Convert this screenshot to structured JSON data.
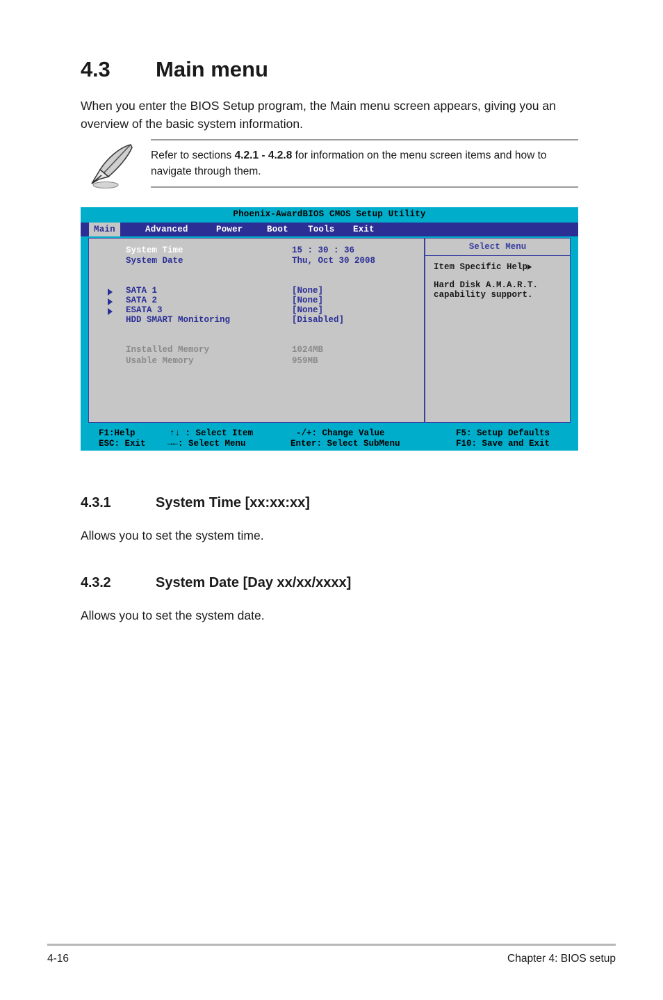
{
  "document": {
    "section": {
      "number": "4.3",
      "title": "Main menu",
      "intro": "When you enter the BIOS Setup program, the Main menu screen appears, giving you an overview of the basic system information."
    },
    "note": {
      "icon": "quill-pen-icon",
      "text_before": "Refer to sections ",
      "text_bold": "4.2.1 - 4.2.8",
      "text_after": " for information on the menu screen items and how to navigate through them."
    },
    "subsections": [
      {
        "number": "4.3.1",
        "title": "System Time [xx:xx:xx]",
        "body": "Allows you to set the system time."
      },
      {
        "number": "4.3.2",
        "title": "System Date [Day xx/xx/xxxx]",
        "body": "Allows you to set the system date."
      }
    ],
    "footer": {
      "page_number": "4-16",
      "chapter": "Chapter 4: BIOS setup"
    }
  },
  "bios": {
    "title": "Phoenix-AwardBIOS CMOS Setup Utility",
    "tabs": [
      {
        "label": "Main",
        "active": true
      },
      {
        "label": "Advanced",
        "active": false
      },
      {
        "label": "Power",
        "active": false
      },
      {
        "label": "Boot",
        "active": false
      },
      {
        "label": "Tools",
        "active": false
      },
      {
        "label": "Exit",
        "active": false
      }
    ],
    "items": [
      {
        "label": "System Time",
        "value": "15 : 30 : 36",
        "style": "selected",
        "submenu": false
      },
      {
        "label": "System Date",
        "value": "Thu, Oct 30 2008",
        "style": "normal",
        "submenu": false
      },
      {
        "label": "SATA 1",
        "value": "[None]",
        "style": "normal",
        "submenu": true
      },
      {
        "label": "SATA 2",
        "value": "[None]",
        "style": "normal",
        "submenu": true
      },
      {
        "label": "ESATA 3",
        "value": "[None]",
        "style": "normal",
        "submenu": true
      },
      {
        "label": "HDD SMART Monitoring",
        "value": "[Disabled]",
        "style": "normal",
        "submenu": false
      },
      {
        "label": "Installed Memory",
        "value": "1024MB",
        "style": "dim",
        "submenu": false
      },
      {
        "label": "Usable Memory",
        "value": "959MB",
        "style": "dim",
        "submenu": false
      }
    ],
    "help": {
      "panel_title": "Select Menu",
      "heading": "Item Specific Help",
      "heading_icon": "triangle-right-icon",
      "lines": [
        "Hard Disk A.M.A.R.T.",
        "capability support."
      ]
    },
    "legend": [
      {
        "key": "F1:Help",
        "col": 0,
        "rowIndex": 0
      },
      {
        "key": "ESC: Exit",
        "col": 0,
        "rowIndex": 1
      },
      {
        "key": "↑↓ : Select Item",
        "col": 1,
        "rowIndex": 0
      },
      {
        "key": "→←: Select Menu",
        "col": 1,
        "rowIndex": 1
      },
      {
        "key": "-/+: Change Value",
        "col": 2,
        "rowIndex": 0
      },
      {
        "key": "Enter: Select SubMenu",
        "col": 2,
        "rowIndex": 1
      },
      {
        "key": "F5: Setup Defaults",
        "col": 3,
        "rowIndex": 0
      },
      {
        "key": "F10: Save and Exit",
        "col": 3,
        "rowIndex": 1
      }
    ],
    "colors": {
      "header_bg": "#00aecb",
      "tabbar_bg": "#2b2f95",
      "panel_bg": "#c6c6c6",
      "border": "#3b3fa0",
      "text_blue": "#2b2f95",
      "text_dim": "#8a8a8a",
      "text_selected": "#ffffff"
    }
  }
}
